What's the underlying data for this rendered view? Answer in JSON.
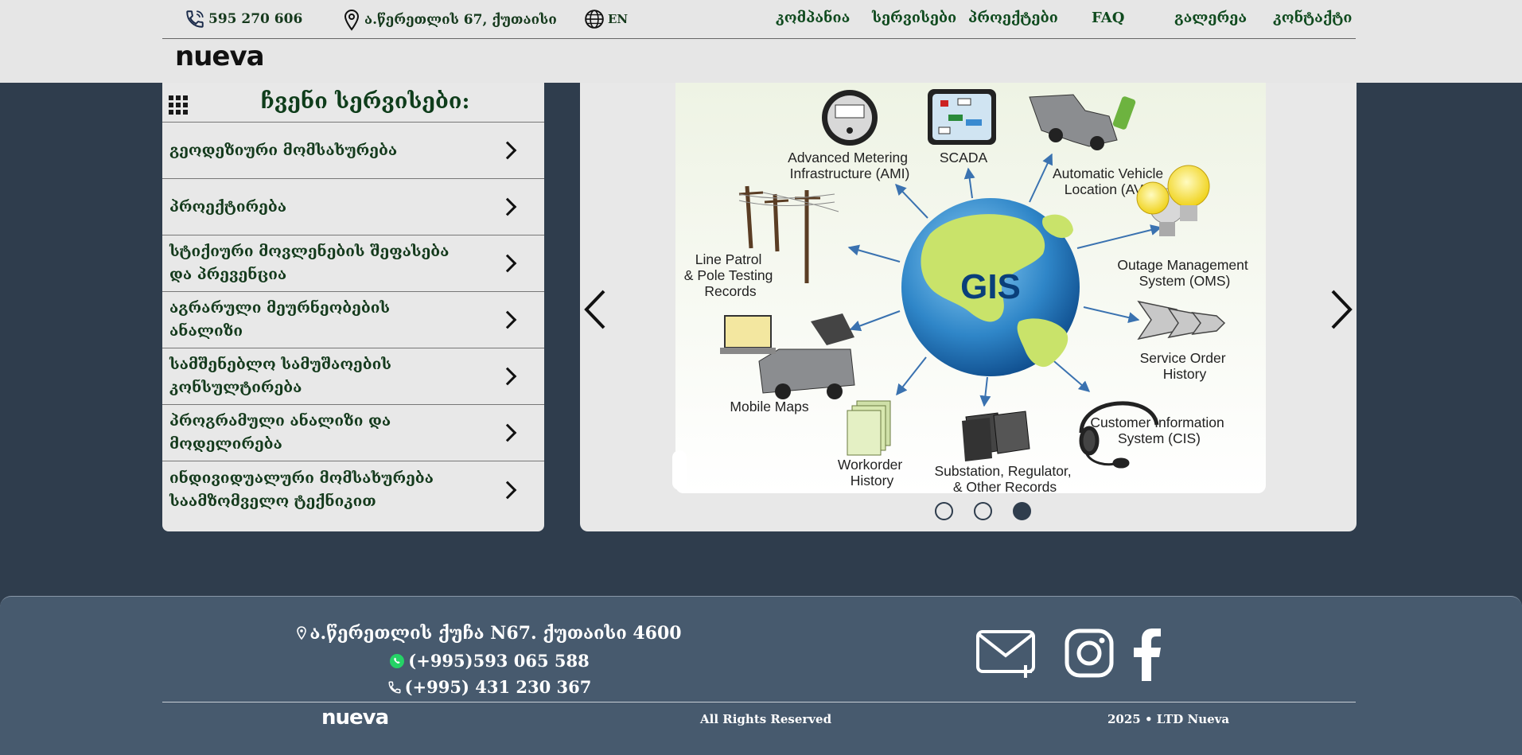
{
  "header": {
    "phone": "595 270 606",
    "address": "ა.წერეთლის 67, ქუთაისი",
    "language": "EN",
    "nav": [
      "კომპანია",
      "სერვისები",
      "პროექტები",
      "FAQ",
      "გალერეა",
      "კონტაქტი"
    ],
    "logo": "nueva"
  },
  "services": {
    "title": "ჩვენი სერვისები:",
    "items": [
      "გეოდეზიური მომსახურება",
      "პროექტირება",
      "სტიქიური მოვლენების შეფასება და პრევენცია",
      "აგრარული მეურნეობების ანალიზი",
      "სამშენებლო სამუშაოების კონსულტირება",
      "პროგრამული ანალიზი და მოდელირება",
      "ინდივიდუალური მომსახურება საამზომველო ტექნიკით"
    ]
  },
  "slide": {
    "center": "GIS",
    "labels": {
      "ami": [
        "Advanced Metering",
        "Infrastructure (AMI)"
      ],
      "scada": [
        "SCADA"
      ],
      "avl": [
        "Automatic Vehicle",
        "Location (AVL)"
      ],
      "line": [
        "Line Patrol",
        "& Pole Testing",
        "Records"
      ],
      "oms": [
        "Outage Management",
        "System (OMS)"
      ],
      "service": [
        "Service Order",
        "History"
      ],
      "maps": [
        "Mobile Maps"
      ],
      "workorder": [
        "Workorder",
        "History"
      ],
      "substation": [
        "Substation, Regulator,",
        "& Other Records"
      ],
      "cis": [
        "Customer Information",
        "System (CIS)"
      ]
    },
    "active_dot": 3,
    "dot_count": 3
  },
  "footer": {
    "address": "ა.წერეთლის ქუჩა N67. ქუთაისი 4600",
    "whatsapp": "(+995)593 065 588",
    "phone": "(+995) 431 230 367",
    "logo": "nueva",
    "rights": "All Rights Reserved",
    "copyright": "2025 • LTD Nueva"
  },
  "colors": {
    "background": "#2f3d4d",
    "footer": "#475a6e",
    "header": "#e6e6e6",
    "text_green": "#0f4a1e"
  }
}
